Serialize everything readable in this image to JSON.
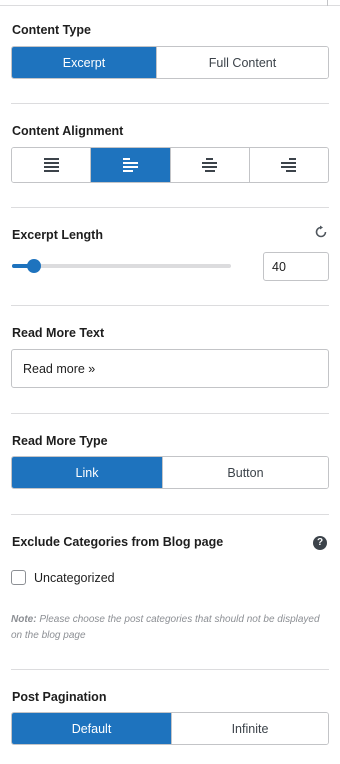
{
  "content_type": {
    "label": "Content Type",
    "options": [
      "Excerpt",
      "Full Content"
    ],
    "selected": "Excerpt"
  },
  "content_alignment": {
    "label": "Content Alignment",
    "options": [
      "justify-icon",
      "align-left-icon",
      "align-center-icon",
      "align-right-icon"
    ],
    "selected": "align-left-icon"
  },
  "excerpt_length": {
    "label": "Excerpt Length",
    "value": "40",
    "slider_fraction": 0.1
  },
  "read_more_text": {
    "label": "Read More Text",
    "value": "Read more »"
  },
  "read_more_type": {
    "label": "Read More Type",
    "options": [
      "Link",
      "Button"
    ],
    "selected": "Link"
  },
  "exclude_categories": {
    "label": "Exclude Categories from Blog page",
    "help_icon": "question-icon",
    "help_glyph": "?",
    "checkbox_label": "Uncategorized",
    "checked": false,
    "note_prefix": "Note:",
    "note_text": " Please choose the post categories that should not be displayed on the blog page"
  },
  "post_pagination": {
    "label": "Post Pagination",
    "options": [
      "Default",
      "Infinite"
    ],
    "selected": "Default"
  },
  "colors": {
    "accent": "#1e73be",
    "border": "#c3c4c7",
    "divider": "#dcdcde"
  }
}
